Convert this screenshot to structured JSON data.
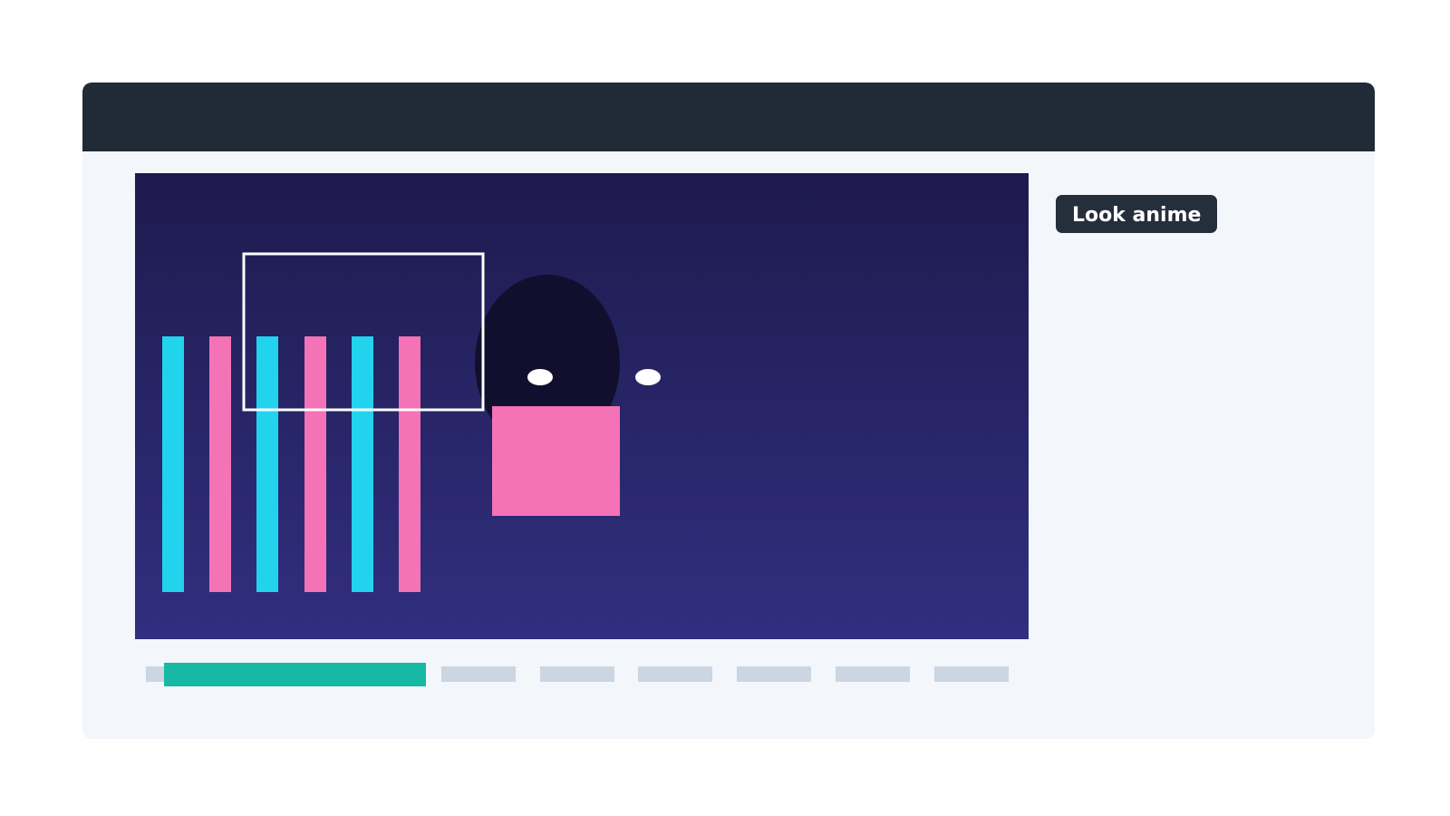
{
  "tooltip": {
    "text": "Look anime"
  },
  "timeline": {
    "progress_fraction": 0.31
  },
  "colors": {
    "titlebar": "#212b38",
    "window_background": "#f3f6fb",
    "canvas_gradient_top": "#1e1a4e",
    "canvas_gradient_bottom": "#322e80",
    "stripe_cyan": "#22d3ee",
    "stripe_pink": "#f472b6",
    "character_head": "#120f2e",
    "character_body": "#f472b6",
    "progress_fill": "#16b9a4",
    "timeline_segment": "#ccd5e2"
  },
  "icons": {
    "character": "anime-character-icon",
    "selection": "selection-box-icon"
  }
}
